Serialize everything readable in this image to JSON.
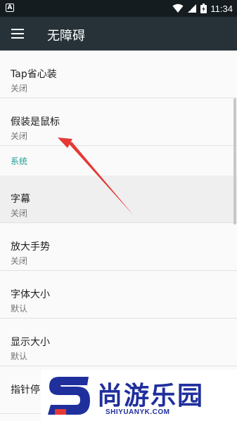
{
  "status_bar": {
    "notification_letter": "A",
    "time": "11:34",
    "icons": [
      "wifi-icon",
      "signal-icon",
      "battery-icon"
    ]
  },
  "app_bar": {
    "title": "无障碍",
    "menu_icon": "hamburger-menu-icon"
  },
  "settings": {
    "items_top": [
      {
        "title": "Tap省心装",
        "summary": "关闭"
      },
      {
        "title": "假装是鼠标",
        "summary": "关闭"
      }
    ],
    "category": "系统",
    "items_bottom": [
      {
        "title": "字幕",
        "summary": "关闭"
      },
      {
        "title": "放大手势",
        "summary": "关闭"
      },
      {
        "title": "字体大小",
        "summary": "默认"
      },
      {
        "title": "显示大小",
        "summary": "默认"
      },
      {
        "title": "指针停"
      }
    ]
  },
  "watermark": {
    "brand": "尚游乐园",
    "domain": "SHIYUANYK.COM"
  },
  "colors": {
    "app_bar": "#263238",
    "status_bar": "#151c20",
    "category_accent": "#21a196",
    "annotation_arrow": "#e53935",
    "watermark_blue": "#1f2f9c"
  }
}
